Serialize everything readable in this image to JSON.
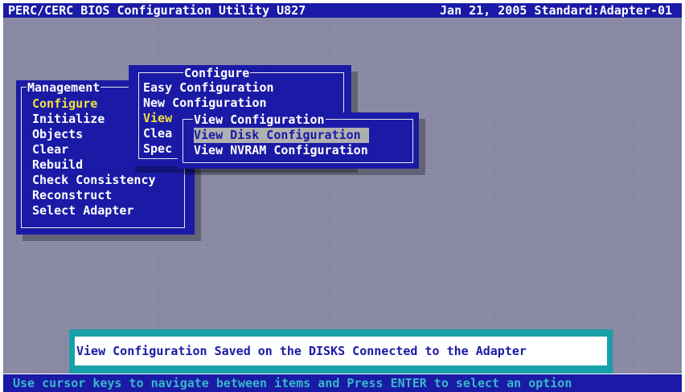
{
  "title_bar": {
    "left": "PERC/CERC BIOS Configuration Utility U827",
    "right": "Jan 21, 2005 Standard:Adapter-01"
  },
  "management_menu": {
    "title": "Management",
    "items": [
      "Configure",
      "Initialize",
      "Objects",
      "Clear",
      "Rebuild",
      "Check Consistency",
      "Reconstruct",
      "Select Adapter"
    ],
    "highlighted": "Configure"
  },
  "configure_menu": {
    "title": "Configure",
    "items": [
      "Easy Configuration",
      "New Configuration",
      "View",
      "Clea",
      "Spec"
    ]
  },
  "view_configuration_menu": {
    "title": "View Configuration",
    "items": [
      "View Disk Configuration",
      "View NVRAM Configuration"
    ],
    "selected": "View Disk Configuration"
  },
  "hint": "View Configuration Saved on the DISKS Connected to the Adapter",
  "status_bar": "Use cursor keys to navigate between items and Press ENTER to select an option",
  "colors": {
    "panel_blue": "#1a1aa6",
    "highlight_yellow": "#f0e040",
    "selection_gray": "#b0b0b0",
    "hint_teal": "#18a0a8",
    "status_text_cyan": "#38b8c8"
  }
}
